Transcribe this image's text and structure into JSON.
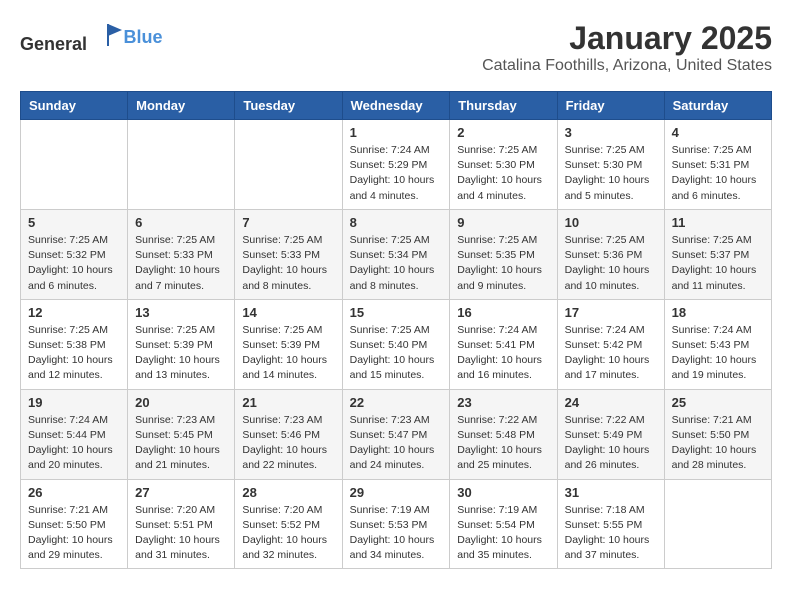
{
  "header": {
    "logo_general": "General",
    "logo_blue": "Blue",
    "month": "January 2025",
    "location": "Catalina Foothills, Arizona, United States"
  },
  "weekdays": [
    "Sunday",
    "Monday",
    "Tuesday",
    "Wednesday",
    "Thursday",
    "Friday",
    "Saturday"
  ],
  "weeks": [
    [
      {
        "day": "",
        "sunrise": "",
        "sunset": "",
        "daylight": ""
      },
      {
        "day": "",
        "sunrise": "",
        "sunset": "",
        "daylight": ""
      },
      {
        "day": "",
        "sunrise": "",
        "sunset": "",
        "daylight": ""
      },
      {
        "day": "1",
        "sunrise": "Sunrise: 7:24 AM",
        "sunset": "Sunset: 5:29 PM",
        "daylight": "Daylight: 10 hours and 4 minutes."
      },
      {
        "day": "2",
        "sunrise": "Sunrise: 7:25 AM",
        "sunset": "Sunset: 5:30 PM",
        "daylight": "Daylight: 10 hours and 4 minutes."
      },
      {
        "day": "3",
        "sunrise": "Sunrise: 7:25 AM",
        "sunset": "Sunset: 5:30 PM",
        "daylight": "Daylight: 10 hours and 5 minutes."
      },
      {
        "day": "4",
        "sunrise": "Sunrise: 7:25 AM",
        "sunset": "Sunset: 5:31 PM",
        "daylight": "Daylight: 10 hours and 6 minutes."
      }
    ],
    [
      {
        "day": "5",
        "sunrise": "Sunrise: 7:25 AM",
        "sunset": "Sunset: 5:32 PM",
        "daylight": "Daylight: 10 hours and 6 minutes."
      },
      {
        "day": "6",
        "sunrise": "Sunrise: 7:25 AM",
        "sunset": "Sunset: 5:33 PM",
        "daylight": "Daylight: 10 hours and 7 minutes."
      },
      {
        "day": "7",
        "sunrise": "Sunrise: 7:25 AM",
        "sunset": "Sunset: 5:33 PM",
        "daylight": "Daylight: 10 hours and 8 minutes."
      },
      {
        "day": "8",
        "sunrise": "Sunrise: 7:25 AM",
        "sunset": "Sunset: 5:34 PM",
        "daylight": "Daylight: 10 hours and 8 minutes."
      },
      {
        "day": "9",
        "sunrise": "Sunrise: 7:25 AM",
        "sunset": "Sunset: 5:35 PM",
        "daylight": "Daylight: 10 hours and 9 minutes."
      },
      {
        "day": "10",
        "sunrise": "Sunrise: 7:25 AM",
        "sunset": "Sunset: 5:36 PM",
        "daylight": "Daylight: 10 hours and 10 minutes."
      },
      {
        "day": "11",
        "sunrise": "Sunrise: 7:25 AM",
        "sunset": "Sunset: 5:37 PM",
        "daylight": "Daylight: 10 hours and 11 minutes."
      }
    ],
    [
      {
        "day": "12",
        "sunrise": "Sunrise: 7:25 AM",
        "sunset": "Sunset: 5:38 PM",
        "daylight": "Daylight: 10 hours and 12 minutes."
      },
      {
        "day": "13",
        "sunrise": "Sunrise: 7:25 AM",
        "sunset": "Sunset: 5:39 PM",
        "daylight": "Daylight: 10 hours and 13 minutes."
      },
      {
        "day": "14",
        "sunrise": "Sunrise: 7:25 AM",
        "sunset": "Sunset: 5:39 PM",
        "daylight": "Daylight: 10 hours and 14 minutes."
      },
      {
        "day": "15",
        "sunrise": "Sunrise: 7:25 AM",
        "sunset": "Sunset: 5:40 PM",
        "daylight": "Daylight: 10 hours and 15 minutes."
      },
      {
        "day": "16",
        "sunrise": "Sunrise: 7:24 AM",
        "sunset": "Sunset: 5:41 PM",
        "daylight": "Daylight: 10 hours and 16 minutes."
      },
      {
        "day": "17",
        "sunrise": "Sunrise: 7:24 AM",
        "sunset": "Sunset: 5:42 PM",
        "daylight": "Daylight: 10 hours and 17 minutes."
      },
      {
        "day": "18",
        "sunrise": "Sunrise: 7:24 AM",
        "sunset": "Sunset: 5:43 PM",
        "daylight": "Daylight: 10 hours and 19 minutes."
      }
    ],
    [
      {
        "day": "19",
        "sunrise": "Sunrise: 7:24 AM",
        "sunset": "Sunset: 5:44 PM",
        "daylight": "Daylight: 10 hours and 20 minutes."
      },
      {
        "day": "20",
        "sunrise": "Sunrise: 7:23 AM",
        "sunset": "Sunset: 5:45 PM",
        "daylight": "Daylight: 10 hours and 21 minutes."
      },
      {
        "day": "21",
        "sunrise": "Sunrise: 7:23 AM",
        "sunset": "Sunset: 5:46 PM",
        "daylight": "Daylight: 10 hours and 22 minutes."
      },
      {
        "day": "22",
        "sunrise": "Sunrise: 7:23 AM",
        "sunset": "Sunset: 5:47 PM",
        "daylight": "Daylight: 10 hours and 24 minutes."
      },
      {
        "day": "23",
        "sunrise": "Sunrise: 7:22 AM",
        "sunset": "Sunset: 5:48 PM",
        "daylight": "Daylight: 10 hours and 25 minutes."
      },
      {
        "day": "24",
        "sunrise": "Sunrise: 7:22 AM",
        "sunset": "Sunset: 5:49 PM",
        "daylight": "Daylight: 10 hours and 26 minutes."
      },
      {
        "day": "25",
        "sunrise": "Sunrise: 7:21 AM",
        "sunset": "Sunset: 5:50 PM",
        "daylight": "Daylight: 10 hours and 28 minutes."
      }
    ],
    [
      {
        "day": "26",
        "sunrise": "Sunrise: 7:21 AM",
        "sunset": "Sunset: 5:50 PM",
        "daylight": "Daylight: 10 hours and 29 minutes."
      },
      {
        "day": "27",
        "sunrise": "Sunrise: 7:20 AM",
        "sunset": "Sunset: 5:51 PM",
        "daylight": "Daylight: 10 hours and 31 minutes."
      },
      {
        "day": "28",
        "sunrise": "Sunrise: 7:20 AM",
        "sunset": "Sunset: 5:52 PM",
        "daylight": "Daylight: 10 hours and 32 minutes."
      },
      {
        "day": "29",
        "sunrise": "Sunrise: 7:19 AM",
        "sunset": "Sunset: 5:53 PM",
        "daylight": "Daylight: 10 hours and 34 minutes."
      },
      {
        "day": "30",
        "sunrise": "Sunrise: 7:19 AM",
        "sunset": "Sunset: 5:54 PM",
        "daylight": "Daylight: 10 hours and 35 minutes."
      },
      {
        "day": "31",
        "sunrise": "Sunrise: 7:18 AM",
        "sunset": "Sunset: 5:55 PM",
        "daylight": "Daylight: 10 hours and 37 minutes."
      },
      {
        "day": "",
        "sunrise": "",
        "sunset": "",
        "daylight": ""
      }
    ]
  ]
}
